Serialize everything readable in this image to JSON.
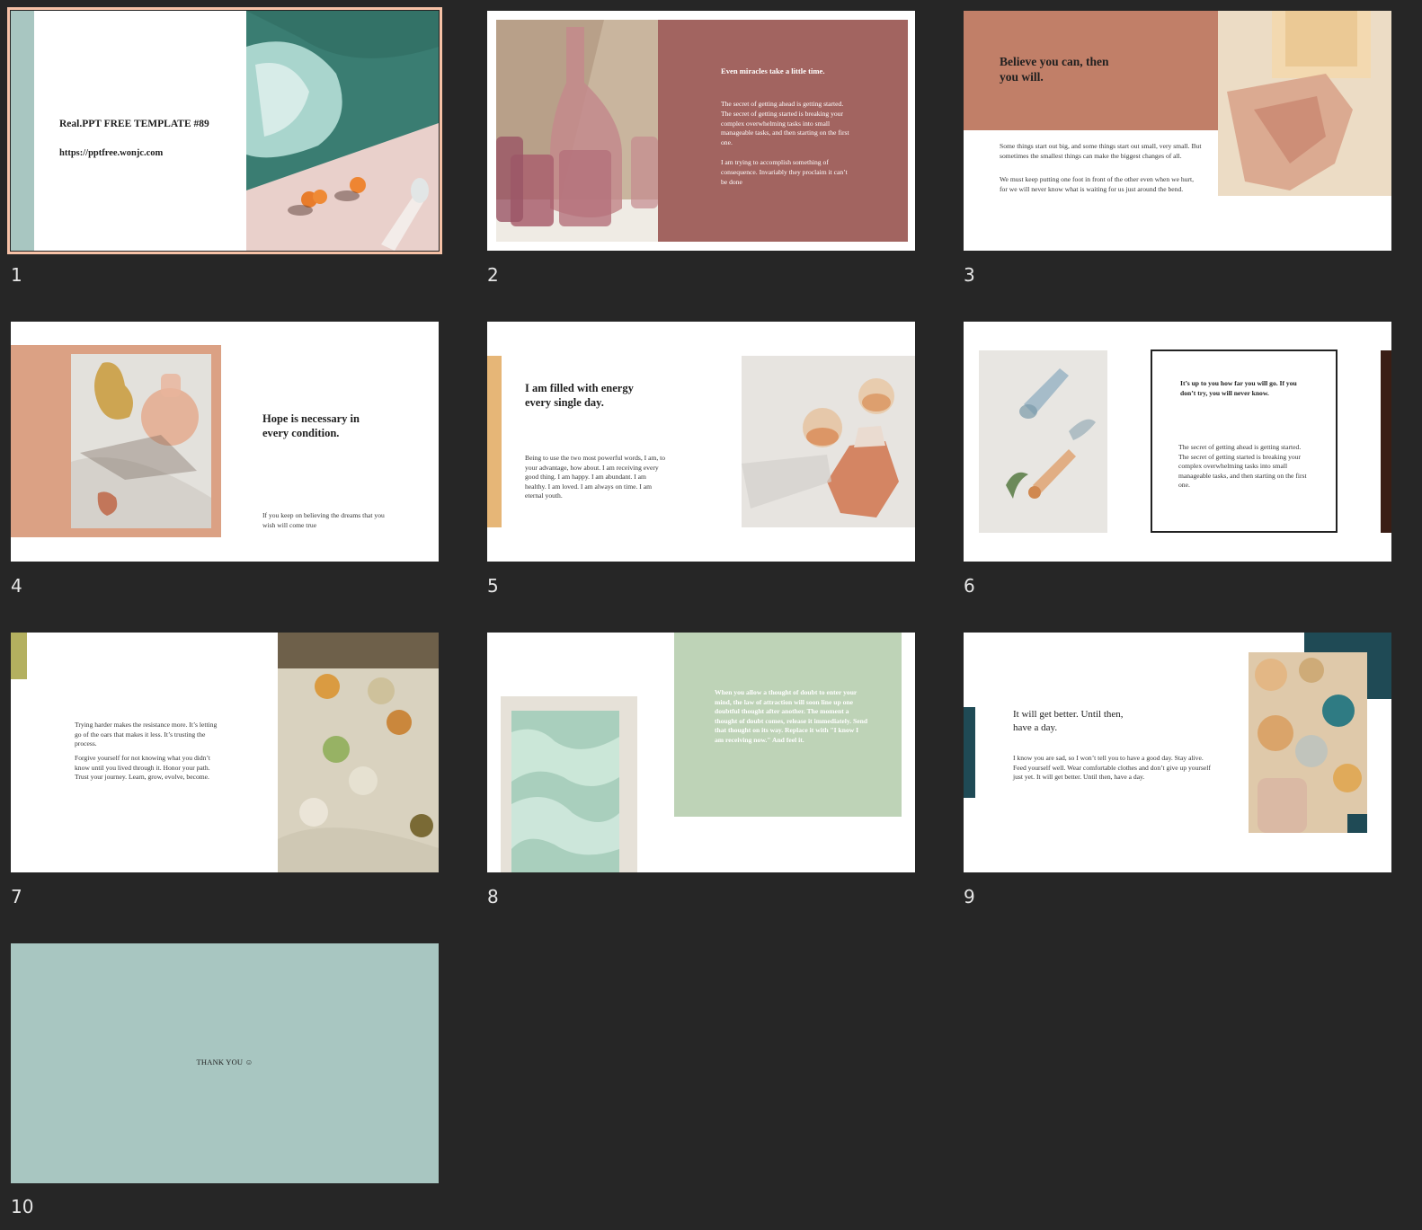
{
  "slides": [
    {
      "number": "1",
      "title": "Real.PPT FREE TEMPLATE #89",
      "url": "https://pptfree.wonjc.com",
      "selected": true
    },
    {
      "number": "2",
      "heading": "Even miracles take a little time.",
      "body": "The secret of  getting ahead is getting started. The secret of  getting started is breaking your complex overwhelming tasks into small manageable tasks, and then starting on the first one.",
      "body2": "I am trying to accomplish something of  consequence. Invariably they proclaim it can’t be done"
    },
    {
      "number": "3",
      "title": "Believe you can, then you will.",
      "body": "Some things start out big, and some things start out small, very small. But sometimes the smallest things can make the biggest changes of  all.",
      "body2": "We must keep putting one foot in front of  the other even when we hurt, for we will never know what is waiting for us just around the bend."
    },
    {
      "number": "4",
      "title": "Hope is necessary in every condition.",
      "body": "If  you keep on believing the dreams that you wish will come true"
    },
    {
      "number": "5",
      "title": "I am filled with energy every single day.",
      "body": "Being to use the two most powerful words, I am, to your advantage, how about. I am receiving every good thing. I am happy. I am abundant. I am healthy. I am loved. I am always on time. I am eternal youth."
    },
    {
      "number": "6",
      "title": "It’s up to you how far you will go. If  you don’t try, you will never know.",
      "body": "The secret of  getting ahead is getting started. The secret of  getting started is breaking your complex overwhelming tasks into small manageable tasks, and then starting on the first one."
    },
    {
      "number": "7",
      "body": "Trying harder makes the resistance more. It’s letting go of  the oars that makes it less. It’s trusting the process.",
      "body2": "Forgive yourself  for not knowing what you didn’t know until you lived through it. Honor your path. Trust your journey. Learn, grow, evolve, become."
    },
    {
      "number": "8",
      "body": "When you allow a thought of doubt to enter your mind, the law of attraction will soon line up one doubtful thought after another. The moment a thought of doubt comes, release it immediately. Send that thought on its way. Replace it with \"I know I am receiving now.\" And feel it."
    },
    {
      "number": "9",
      "title": "It will get better. Until then, have a day.",
      "body": "I know you are sad, so I won’t tell you to have a good day. Stay alive. Feed yourself  well. Wear comfortable clothes and don’t give up yourself  just yet. It will get better. Until then, have a day."
    },
    {
      "number": "10",
      "title": "THANK YOU ☺"
    }
  ],
  "colors": {
    "background": "#262626",
    "selection": "#f6c1a6",
    "teal": "#a8c6c1",
    "rose": "#a26460",
    "terracotta": "#c17f68",
    "peach": "#dba184",
    "gold": "#e6b677",
    "olive": "#b3b05f",
    "sage": "#bed3b7",
    "dark_teal": "#1f4a55",
    "dark_brown": "#3a1e15"
  }
}
